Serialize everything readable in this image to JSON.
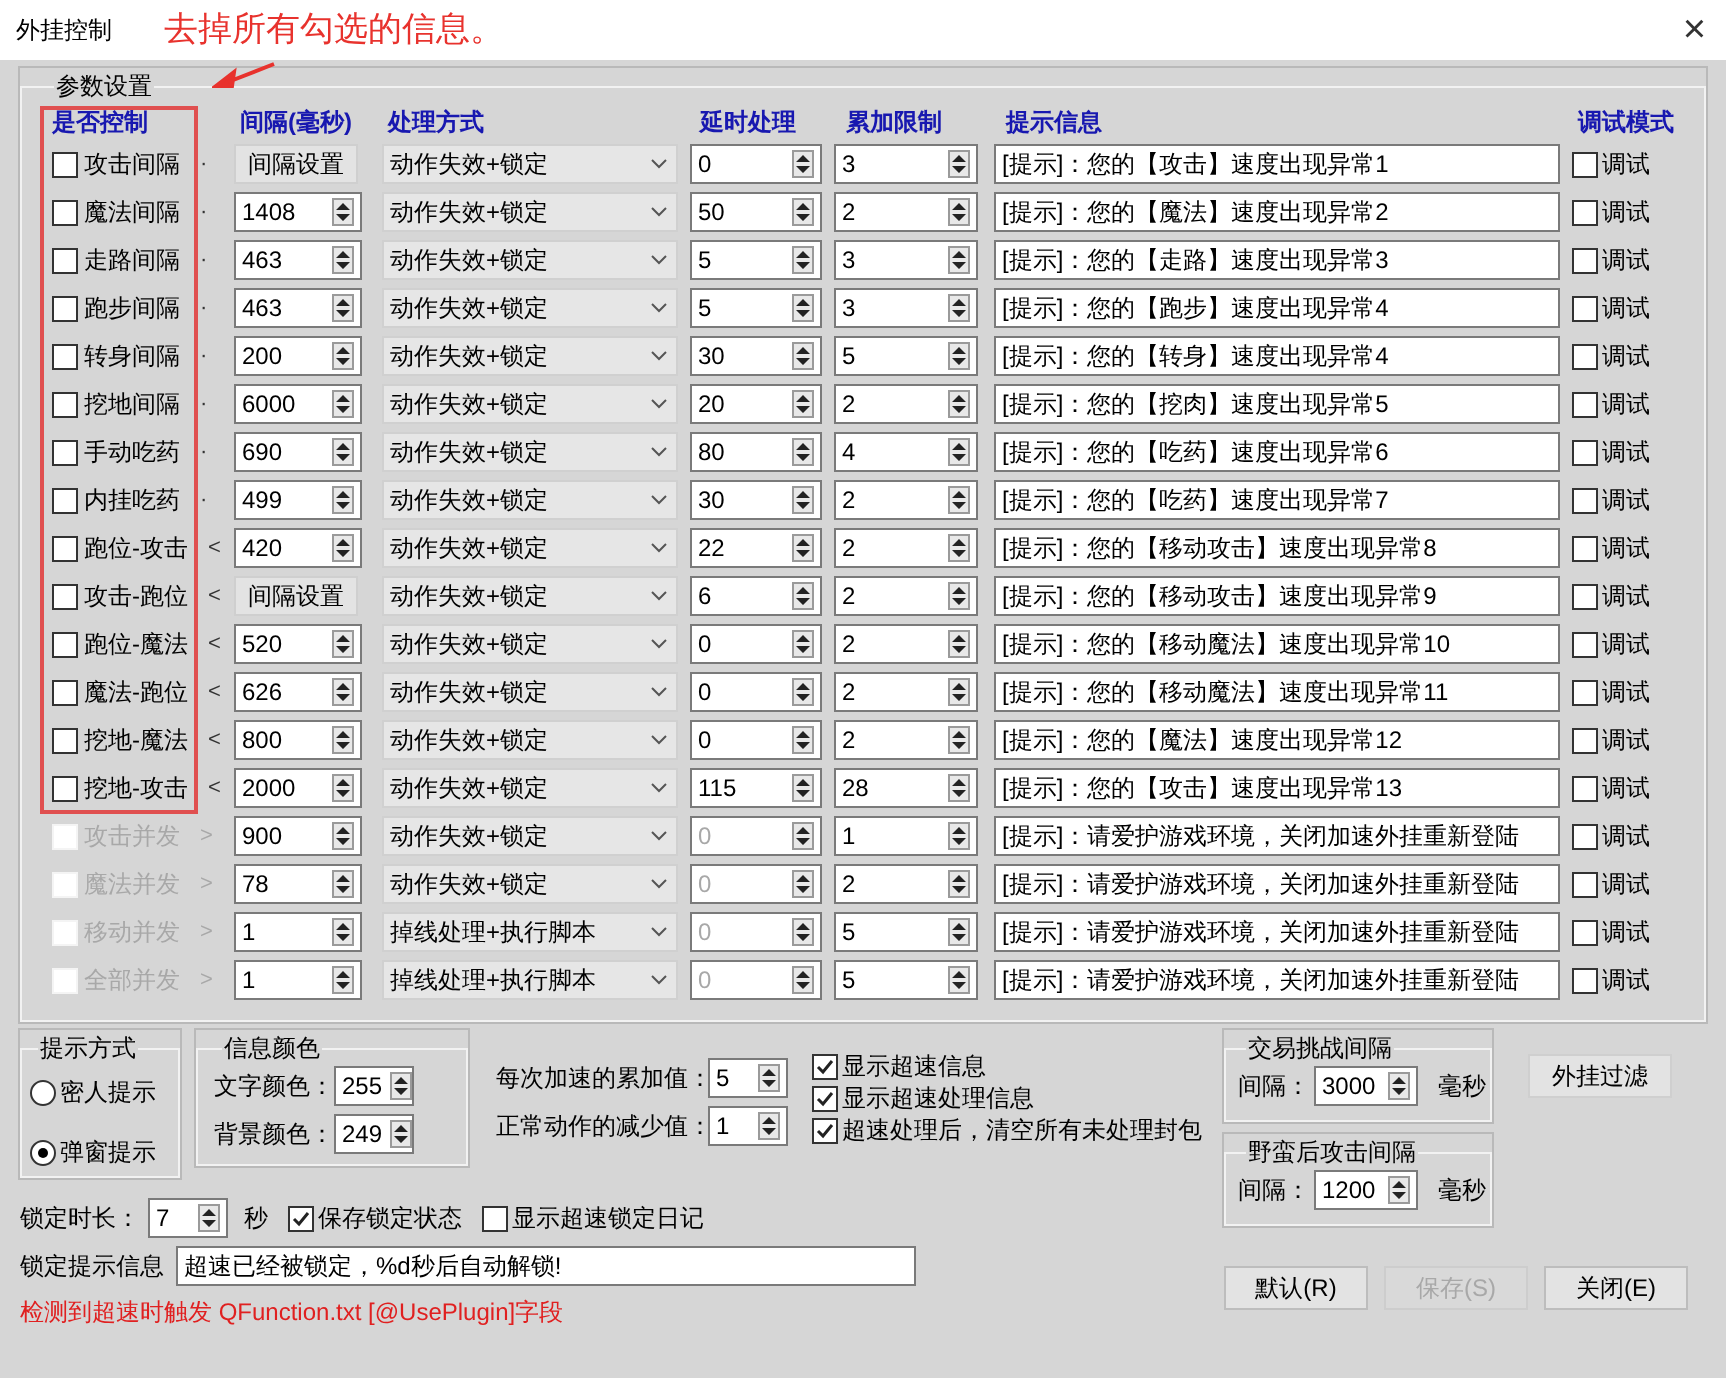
{
  "window": {
    "title": "外挂控制",
    "close": "×"
  },
  "annotation": "去掉所有勾选的信息。",
  "params": {
    "legend": "参数设置",
    "columns": [
      "是否控制",
      "间隔(毫秒)",
      "处理方式",
      "延时处理",
      "累加限制",
      "提示信息",
      "调试模式"
    ],
    "rows": [
      {
        "label": "攻击间隔",
        "suffix": "·",
        "checked": false,
        "disabled": false,
        "interval": {
          "kind": "button",
          "value": "间隔设置"
        },
        "method": "动作失效+锁定",
        "delay": "0",
        "limit": "3",
        "tip": "[提示]：您的【攻击】速度出现异常1",
        "debug": {
          "label": "调试",
          "checked": false
        }
      },
      {
        "label": "魔法间隔",
        "suffix": "·",
        "checked": false,
        "disabled": false,
        "interval": {
          "kind": "spin",
          "value": "1408"
        },
        "method": "动作失效+锁定",
        "delay": "50",
        "limit": "2",
        "tip": "[提示]：您的【魔法】速度出现异常2",
        "debug": {
          "label": "调试",
          "checked": false
        }
      },
      {
        "label": "走路间隔",
        "suffix": "·",
        "checked": false,
        "disabled": false,
        "interval": {
          "kind": "spin",
          "value": "463"
        },
        "method": "动作失效+锁定",
        "delay": "5",
        "limit": "3",
        "tip": "[提示]：您的【走路】速度出现异常3",
        "debug": {
          "label": "调试",
          "checked": false
        }
      },
      {
        "label": "跑步间隔",
        "suffix": "·",
        "checked": false,
        "disabled": false,
        "interval": {
          "kind": "spin",
          "value": "463"
        },
        "method": "动作失效+锁定",
        "delay": "5",
        "limit": "3",
        "tip": "[提示]：您的【跑步】速度出现异常4",
        "debug": {
          "label": "调试",
          "checked": false
        }
      },
      {
        "label": "转身间隔",
        "suffix": "·",
        "checked": false,
        "disabled": false,
        "interval": {
          "kind": "spin",
          "value": "200"
        },
        "method": "动作失效+锁定",
        "delay": "30",
        "limit": "5",
        "tip": "[提示]：您的【转身】速度出现异常4",
        "debug": {
          "label": "调试",
          "checked": false
        }
      },
      {
        "label": "挖地间隔",
        "suffix": "·",
        "checked": false,
        "disabled": false,
        "interval": {
          "kind": "spin",
          "value": "6000"
        },
        "method": "动作失效+锁定",
        "delay": "20",
        "limit": "2",
        "tip": "[提示]：您的【挖肉】速度出现异常5",
        "debug": {
          "label": "调试",
          "checked": false
        }
      },
      {
        "label": "手动吃药",
        "suffix": "·",
        "checked": false,
        "disabled": false,
        "interval": {
          "kind": "spin",
          "value": "690"
        },
        "method": "动作失效+锁定",
        "delay": "80",
        "limit": "4",
        "tip": "[提示]：您的【吃药】速度出现异常6",
        "debug": {
          "label": "调试",
          "checked": false
        }
      },
      {
        "label": "内挂吃药",
        "suffix": "·",
        "checked": false,
        "disabled": false,
        "interval": {
          "kind": "spin",
          "value": "499"
        },
        "method": "动作失效+锁定",
        "delay": "30",
        "limit": "2",
        "tip": "[提示]：您的【吃药】速度出现异常7",
        "debug": {
          "label": "调试",
          "checked": false
        }
      },
      {
        "label": "跑位-攻击",
        "suffix": "<",
        "checked": false,
        "disabled": false,
        "interval": {
          "kind": "spin",
          "value": "420"
        },
        "method": "动作失效+锁定",
        "delay": "22",
        "limit": "2",
        "tip": "[提示]：您的【移动攻击】速度出现异常8",
        "debug": {
          "label": "调试",
          "checked": false
        }
      },
      {
        "label": "攻击-跑位",
        "suffix": "<",
        "checked": false,
        "disabled": false,
        "interval": {
          "kind": "button",
          "value": "间隔设置"
        },
        "method": "动作失效+锁定",
        "delay": "6",
        "limit": "2",
        "tip": "[提示]：您的【移动攻击】速度出现异常9",
        "debug": {
          "label": "调试",
          "checked": false
        }
      },
      {
        "label": "跑位-魔法",
        "suffix": "<",
        "checked": false,
        "disabled": false,
        "interval": {
          "kind": "spin",
          "value": "520"
        },
        "method": "动作失效+锁定",
        "delay": "0",
        "limit": "2",
        "tip": "[提示]：您的【移动魔法】速度出现异常10",
        "debug": {
          "label": "调试",
          "checked": false
        }
      },
      {
        "label": "魔法-跑位",
        "suffix": "<",
        "checked": false,
        "disabled": false,
        "interval": {
          "kind": "spin",
          "value": "626"
        },
        "method": "动作失效+锁定",
        "delay": "0",
        "limit": "2",
        "tip": "[提示]：您的【移动魔法】速度出现异常11",
        "debug": {
          "label": "调试",
          "checked": false
        }
      },
      {
        "label": "挖地-魔法",
        "suffix": "<",
        "checked": false,
        "disabled": false,
        "interval": {
          "kind": "spin",
          "value": "800"
        },
        "method": "动作失效+锁定",
        "delay": "0",
        "limit": "2",
        "tip": "[提示]：您的【魔法】速度出现异常12",
        "debug": {
          "label": "调试",
          "checked": false
        }
      },
      {
        "label": "挖地-攻击",
        "suffix": "<",
        "checked": false,
        "disabled": false,
        "interval": {
          "kind": "spin",
          "value": "2000"
        },
        "method": "动作失效+锁定",
        "delay": "115",
        "limit": "28",
        "tip": "[提示]：您的【攻击】速度出现异常13",
        "debug": {
          "label": "调试",
          "checked": false
        }
      },
      {
        "label": "攻击并发",
        "suffix": ">",
        "checked": false,
        "disabled": true,
        "interval": {
          "kind": "spin",
          "value": "900"
        },
        "method": "动作失效+锁定",
        "delay": "0",
        "limit": "1",
        "tip": "[提示]：请爱护游戏环境，关闭加速外挂重新登陆",
        "debug": {
          "label": "调试",
          "checked": false
        }
      },
      {
        "label": "魔法并发",
        "suffix": ">",
        "checked": false,
        "disabled": true,
        "interval": {
          "kind": "spin",
          "value": "78"
        },
        "method": "动作失效+锁定",
        "delay": "0",
        "limit": "2",
        "tip": "[提示]：请爱护游戏环境，关闭加速外挂重新登陆",
        "debug": {
          "label": "调试",
          "checked": false
        }
      },
      {
        "label": "移动并发",
        "suffix": ">",
        "checked": false,
        "disabled": true,
        "interval": {
          "kind": "spin",
          "value": "1"
        },
        "method": "掉线处理+执行脚本",
        "delay": "0",
        "limit": "5",
        "tip": "[提示]：请爱护游戏环境，关闭加速外挂重新登陆",
        "debug": {
          "label": "调试",
          "checked": false
        }
      },
      {
        "label": "全部并发",
        "suffix": ">",
        "checked": false,
        "disabled": true,
        "interval": {
          "kind": "spin",
          "value": "1"
        },
        "method": "掉线处理+执行脚本",
        "delay": "0",
        "limit": "5",
        "tip": "[提示]：请爱护游戏环境，关闭加速外挂重新登陆",
        "debug": {
          "label": "调试",
          "checked": false
        }
      }
    ]
  },
  "hint_mode": {
    "legend": "提示方式",
    "options": [
      {
        "label": "密人提示",
        "selected": false
      },
      {
        "label": "弹窗提示",
        "selected": true
      }
    ]
  },
  "info_color": {
    "legend": "信息颜色",
    "fields": [
      {
        "label": "文字颜色：",
        "value": "255"
      },
      {
        "label": "背景颜色：",
        "value": "249"
      }
    ]
  },
  "accel": [
    {
      "label": "每次加速的累加值：",
      "value": "5"
    },
    {
      "label": "正常动作的减少值：",
      "value": "1"
    }
  ],
  "options": [
    {
      "label": "显示超速信息",
      "checked": true
    },
    {
      "label": "显示超速处理信息",
      "checked": true
    },
    {
      "label": "超速处理后，清空所有未处理封包",
      "checked": true
    }
  ],
  "intervals": [
    {
      "legend": "交易挑战间隔",
      "label": "间隔：",
      "value": "3000",
      "unit": "毫秒"
    },
    {
      "legend": "野蛮后攻击间隔",
      "label": "间隔：",
      "value": "1200",
      "unit": "毫秒"
    }
  ],
  "filter_button": "外挂过滤",
  "lock": {
    "label": "锁定时长：",
    "value": "7",
    "unit": "秒",
    "options": [
      {
        "label": "保存锁定状态",
        "checked": true
      },
      {
        "label": "显示超速锁定日记",
        "checked": false
      }
    ]
  },
  "lock_message": {
    "label": "锁定提示信息",
    "value": "超速已经被锁定，%d秒后自动解锁!"
  },
  "trigger_note": "检测到超速时触发 QFunction.txt [@UsePlugin]字段",
  "buttons": [
    {
      "label": "默认(R)",
      "disabled": false
    },
    {
      "label": "保存(S)",
      "disabled": true
    },
    {
      "label": "关闭(E)",
      "disabled": false
    }
  ]
}
